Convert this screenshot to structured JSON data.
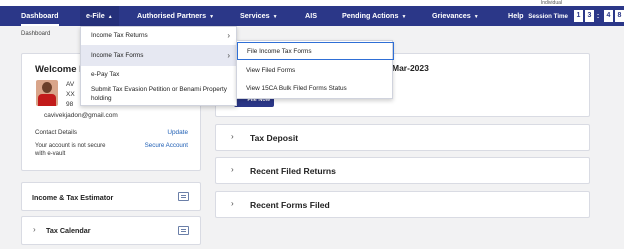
{
  "header": {
    "corner_text": "Individual",
    "nav": [
      {
        "label": "Dashboard",
        "caret": false
      },
      {
        "label": "e-File",
        "caret": true
      },
      {
        "label": "Authorised Partners",
        "caret": true
      },
      {
        "label": "Services",
        "caret": true
      },
      {
        "label": "AIS",
        "caret": false
      },
      {
        "label": "Pending Actions",
        "caret": true
      },
      {
        "label": "Grievances",
        "caret": true
      },
      {
        "label": "Help",
        "caret": false
      }
    ],
    "session_label": "Session Time",
    "session_digits": [
      "1",
      "3",
      ":",
      "4",
      "8"
    ]
  },
  "breadcrumb": "Dashboard",
  "profile": {
    "welcome": "Welcome B",
    "line1": "AV",
    "line2": "XX",
    "line3": "98",
    "email": "cavivekjadon@gmail.com",
    "contact_label": "Contact Details",
    "update": "Update",
    "not_secure": "Your account is not secure with e-vault",
    "secure_link": "Secure Account"
  },
  "estimator": {
    "label": "Income & Tax Estimator",
    "icon": "calculator-icon"
  },
  "calendar": {
    "label": "Tax Calendar",
    "icon": "calendar-icon"
  },
  "main": {
    "partial_title": "Mar-2023",
    "file_now": "File Now"
  },
  "accordions": [
    "Tax Deposit",
    "Recent Filed Returns",
    "Recent Forms Filed"
  ],
  "efile_menu": {
    "items": [
      "Income Tax Returns",
      "Income Tax Forms",
      "e-Pay Tax",
      "Submit Tax Evasion Petition or Benami Property holding"
    ],
    "highlighted": "Income Tax Forms"
  },
  "forms_submenu": {
    "items": [
      "File Income Tax Forms",
      "View Filed Forms",
      "View 15CA Bulk Filed Forms Status"
    ],
    "selected": "File Income Tax Forms"
  },
  "colors": {
    "nav_bg": "#2b3788",
    "link": "#1f5fb5",
    "selection": "#2f6fd6"
  }
}
